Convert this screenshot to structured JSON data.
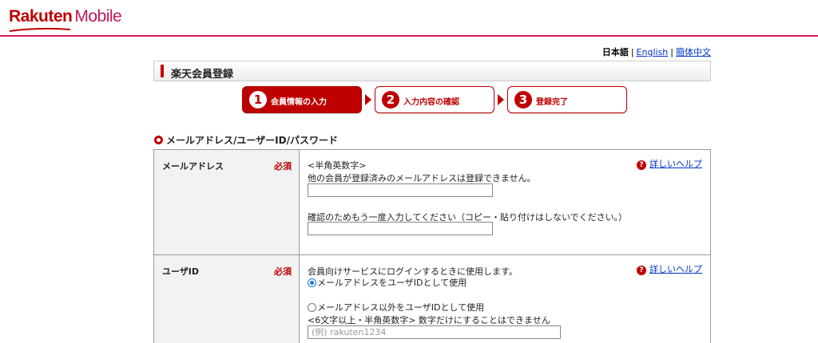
{
  "brand": {
    "name": "Rakuten",
    "product": "Mobile"
  },
  "language": {
    "current": "日本語",
    "sep1": "|",
    "english": "English",
    "sep2": "|",
    "chinese": "簡体中文"
  },
  "page": {
    "title": "楽天会員登録"
  },
  "steps": [
    {
      "num": "1",
      "label": "会員情報の入力",
      "active": true
    },
    {
      "num": "2",
      "label": "入力内容の確認",
      "active": false
    },
    {
      "num": "3",
      "label": "登録完了",
      "active": false
    }
  ],
  "section": {
    "title": "メールアドレス/ユーザーID/パスワード"
  },
  "email_row": {
    "label": "メールアドレス",
    "required": "必須",
    "help": "詳しいヘルプ",
    "help_icon": "?",
    "note1": "<半角英数字>",
    "note2": "他の会員が登録済みのメールアドレスは登録できません。",
    "confirm_note": "確認のためもう一度入力してください（コピー・貼り付けはしないでください。）",
    "email_value": "",
    "confirm_value": ""
  },
  "userid_row": {
    "label": "ユーザID",
    "required": "必須",
    "help": "詳しいヘルプ",
    "help_icon": "?",
    "note": "会員向けサービスにログインするときに使用します。",
    "option1": "メールアドレスをユーザIDとして使用",
    "option2": "メールアドレス以外をユーザIDとして使用",
    "rule": "<6文字以上・半角英数字> 数字だけにすることはできません",
    "placeholder": "(例) rakuten1234",
    "selected_option": 1
  },
  "colors": {
    "brand": "#bf0000",
    "header_line": "#d81b60",
    "link": "#0033cc"
  }
}
